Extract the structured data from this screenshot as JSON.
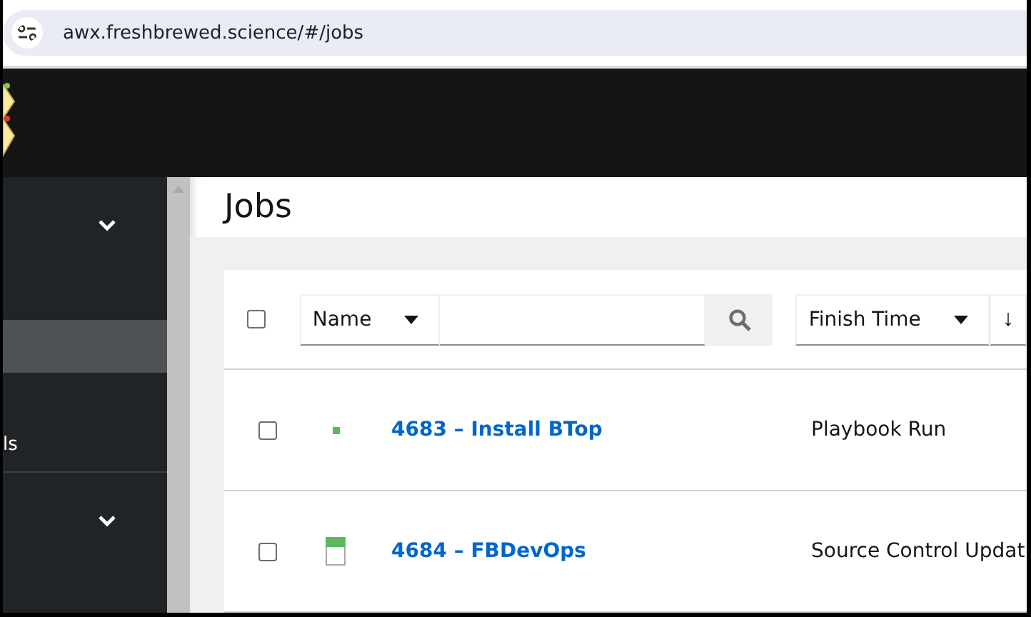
{
  "address_bar": {
    "url": "awx.freshbrewed.science/#/jobs"
  },
  "sidebar": {
    "items": [
      {
        "kind": "group",
        "selected": false
      },
      {
        "kind": "item",
        "selected": true
      },
      {
        "kind": "item",
        "label": "ls",
        "selected": false
      },
      {
        "kind": "group",
        "selected": false
      }
    ]
  },
  "page": {
    "title": "Jobs"
  },
  "toolbar": {
    "select_all": {
      "checked": false
    },
    "filter_field": "Name",
    "sort_field": "Finish Time",
    "sort_direction": "↓"
  },
  "table": {
    "rows": [
      {
        "checked": false,
        "kind": "dot",
        "name": "4683 – Install BTop",
        "type": "Playbook Run"
      },
      {
        "checked": false,
        "kind": "bar",
        "name": "4684 – FBDevOps",
        "type": "Source Control Updat"
      }
    ]
  }
}
